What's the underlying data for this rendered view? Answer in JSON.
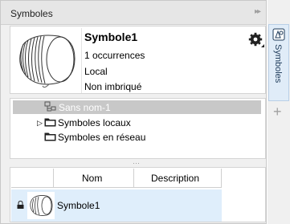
{
  "docker": {
    "title": "Symboles",
    "dock_button": "▸▸"
  },
  "properties": {
    "symbol_name": "Symbole1",
    "occurrences": "1 occurrences",
    "scope": "Local",
    "nesting": "Non imbriqué",
    "options_icon": "gear-icon"
  },
  "tree": {
    "items": [
      {
        "label": "Sans nom-1",
        "icon": "document-tree-icon",
        "selected": true
      },
      {
        "label": "Symboles locaux",
        "icon": "folder-icon",
        "expandable": true
      },
      {
        "label": "Symboles en réseau",
        "icon": "folder-icon"
      }
    ]
  },
  "splitter": "⋯",
  "list": {
    "columns": [
      "Nom",
      "Description"
    ],
    "rows": [
      {
        "name": "Symbole1",
        "description": "",
        "icon": "lock-icon"
      }
    ]
  },
  "rail": {
    "tab_label": "Symboles",
    "tab_icon": "symbols-icon",
    "add_icon": "plus-icon",
    "add_label": "+"
  },
  "colors": {
    "selection": "#c8c8c8",
    "row_highlight": "#dfeefb",
    "rail_tab": "#e0ecf8"
  }
}
